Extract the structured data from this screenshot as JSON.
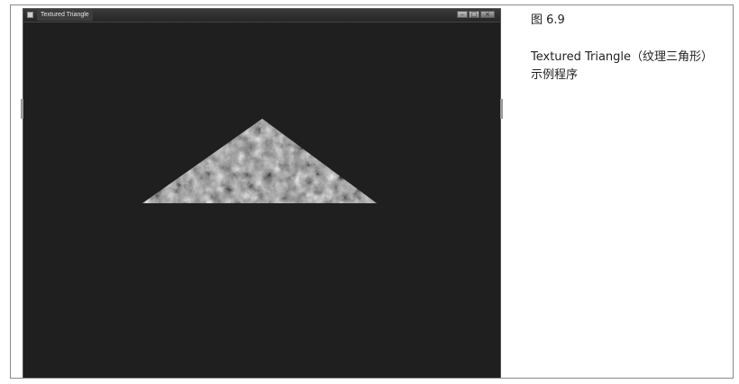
{
  "window": {
    "title": "Textured Triangle",
    "minimize_glyph": "–",
    "maximize_glyph": "□",
    "close_glyph": "×"
  },
  "caption": {
    "figure_number": "图 6.9",
    "line1": "Textured Triangle（纹理三角形）",
    "line2": "示例程序"
  },
  "colors": {
    "canvas_background": "#1f1f1f",
    "texture_light": "#bdbdbd",
    "texture_dark": "#2e2e2e"
  },
  "icons": {
    "app": "app-icon",
    "minimize": "minimize-icon",
    "maximize": "maximize-icon",
    "close": "close-icon"
  }
}
